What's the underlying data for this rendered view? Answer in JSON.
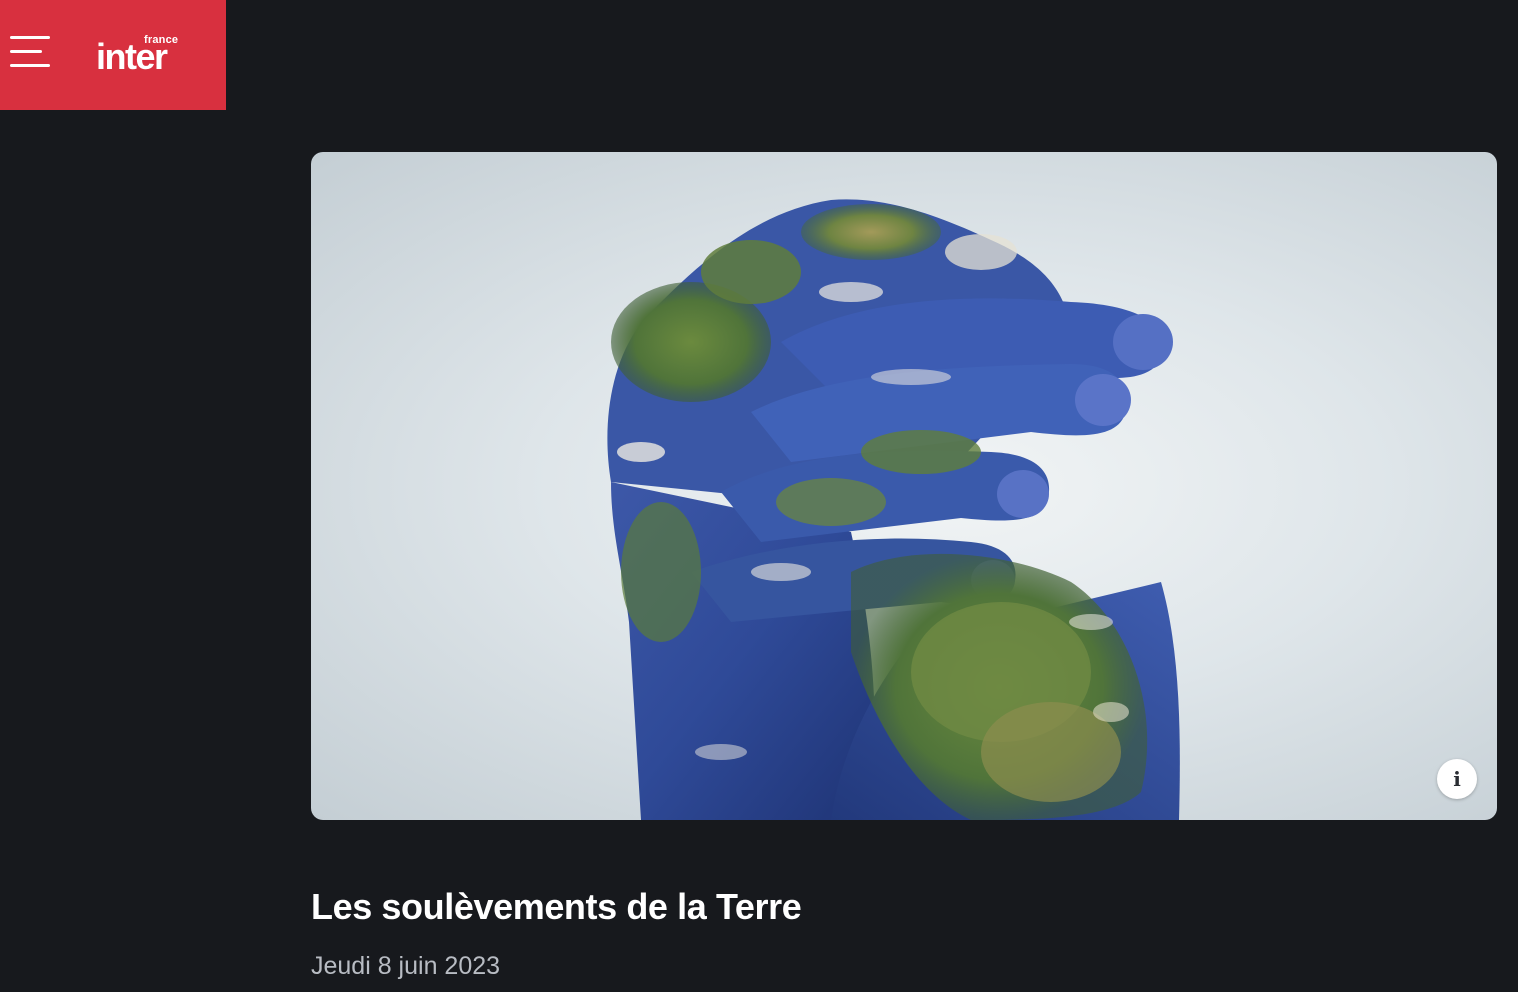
{
  "header": {
    "menu_icon": "hamburger-menu-icon",
    "logo_small": "france",
    "logo_main": "inter",
    "brand_color": "#d8303f"
  },
  "hero": {
    "info_icon": "info-icon",
    "info_label": "i"
  },
  "article": {
    "title": "Les soulèvements de la Terre",
    "date": "Jeudi 8 juin 2023"
  },
  "colors": {
    "background": "#17191d",
    "title": "#ffffff",
    "date": "#b8bcc3"
  }
}
